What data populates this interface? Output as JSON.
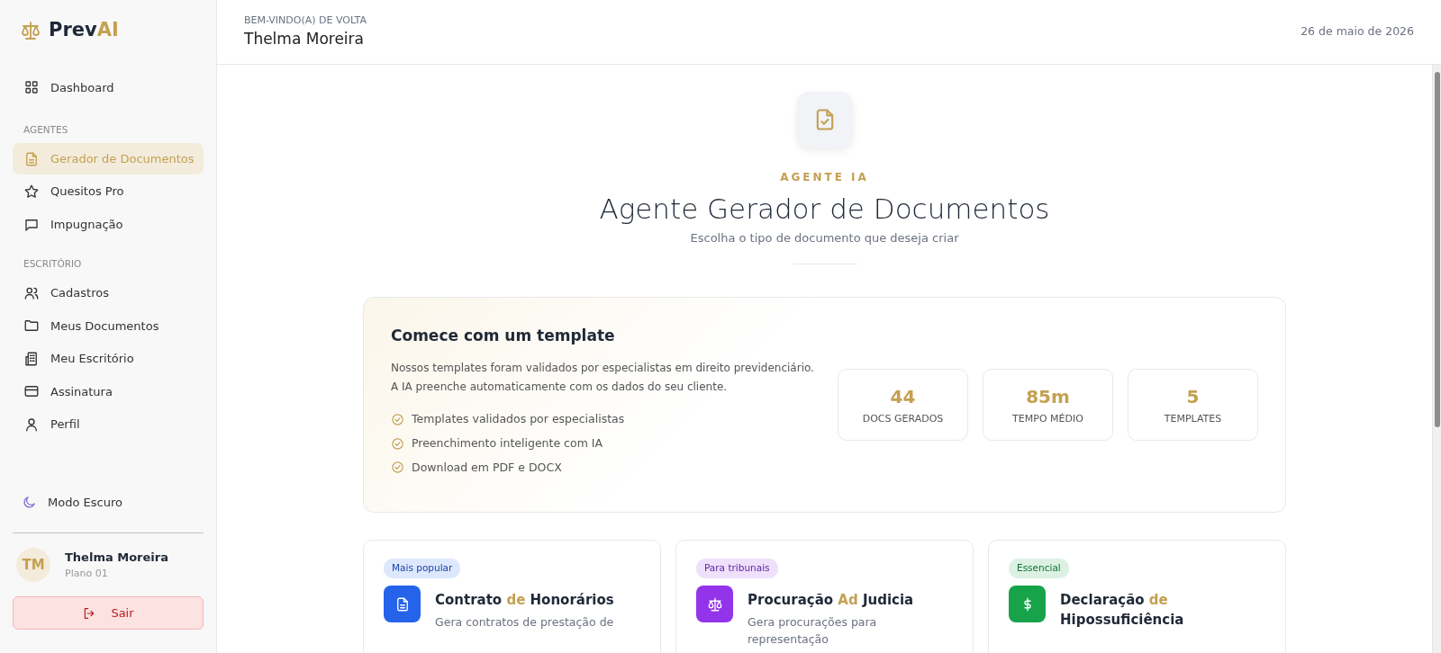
{
  "brand": {
    "parts": [
      {
        "text": "Prev",
        "accent": false
      },
      {
        "text": "AI",
        "accent": true
      }
    ]
  },
  "sidebar": {
    "sections": [
      {
        "items": [
          {
            "label": "Dashboard",
            "selected": false
          }
        ]
      },
      {
        "heading": "AGENTES",
        "items": [
          {
            "label": "Gerador de Documentos",
            "selected": true
          },
          {
            "label": "Quesitos Pro",
            "selected": false
          },
          {
            "label": "Impugnação",
            "selected": false
          }
        ]
      },
      {
        "heading": "ESCRITÓRIO",
        "items": [
          {
            "label": "Cadastros",
            "selected": false
          },
          {
            "label": "Meus Documentos",
            "selected": false
          },
          {
            "label": "Meu Escritório",
            "selected": false
          },
          {
            "label": "Assinatura",
            "selected": false
          },
          {
            "label": "Perfil",
            "selected": false
          }
        ]
      }
    ],
    "dark_mode": {
      "label": "Modo Escuro",
      "on": false
    },
    "user": {
      "initials": "TM",
      "name": "Thelma Moreira",
      "plan": "Plano 01"
    },
    "logout": {
      "label": "Sair"
    }
  },
  "header": {
    "greeting": "BEM-VINDO(A) DE VOLTA",
    "name": "Thelma Moreira",
    "date": "26 de maio de 2026"
  },
  "hero": {
    "eyebrow": "AGENTE IA",
    "title": "Agente Gerador de Documentos",
    "subtitle": "Escolha o tipo de documento que deseja criar"
  },
  "intro": {
    "title": "Comece com um template",
    "text": "Nossos templates foram validados por especialistas em direito previdenciário. A IA preenche automaticamente com os dados do seu cliente.",
    "features": [
      "Templates validados por especialistas",
      "Preenchimento inteligente com IA",
      "Download em PDF e DOCX"
    ],
    "stats": [
      {
        "value": "44",
        "label": "DOCS GERADOS"
      },
      {
        "value": "85m",
        "label": "TEMPO MÉDIO"
      },
      {
        "value": "5",
        "label": "TEMPLATES"
      }
    ]
  },
  "templates": [
    {
      "badge": "Mais popular",
      "color": "#2563eb",
      "title": [
        {
          "text": "Contrato ",
          "accent": false
        },
        {
          "text": "de",
          "accent": true
        },
        {
          "text": " Honorários",
          "accent": false
        }
      ],
      "description": "Gera contratos de prestação de"
    },
    {
      "badge": "Para tribunais",
      "color": "#9333ea",
      "title": [
        {
          "text": "Procuração ",
          "accent": false
        },
        {
          "text": "Ad",
          "accent": true
        },
        {
          "text": " Judicia",
          "accent": false
        }
      ],
      "description": "Gera procurações para representação"
    },
    {
      "badge": "Essencial",
      "color": "#16a34a",
      "title": [
        {
          "text": "Declaração ",
          "accent": false
        },
        {
          "text": "de",
          "accent": true
        },
        {
          "text": " Hipossuficiência",
          "accent": false
        }
      ]
    }
  ]
}
